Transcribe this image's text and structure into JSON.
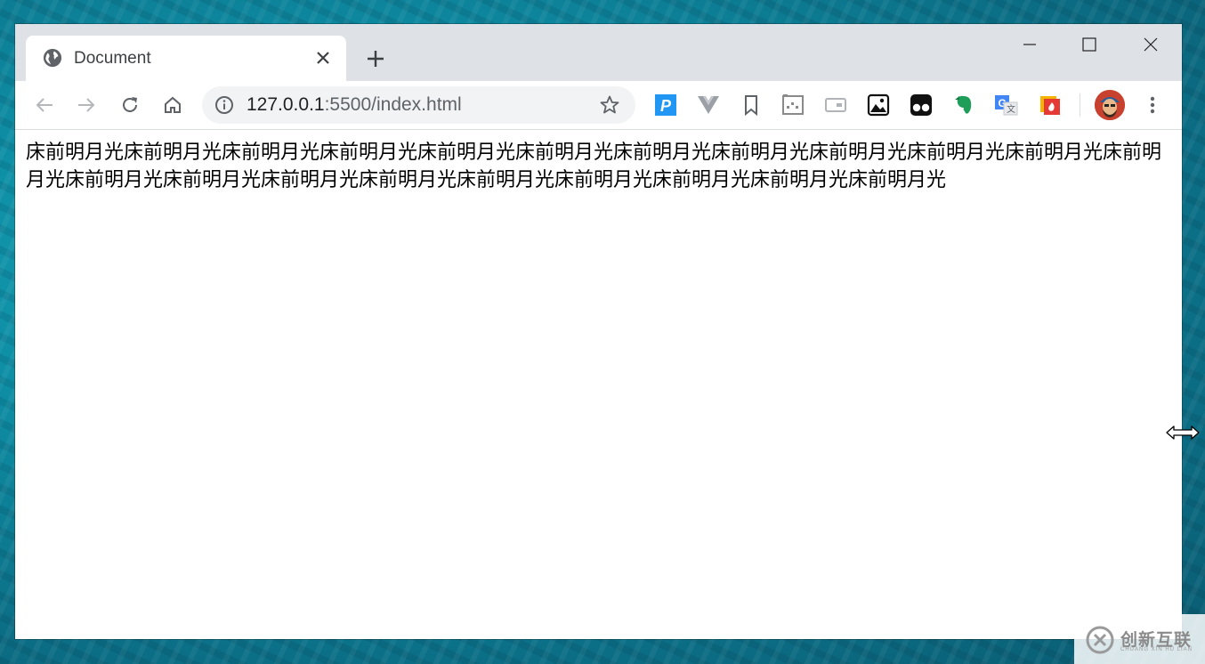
{
  "tab": {
    "title": "Document",
    "favicon": "globe-icon"
  },
  "window_controls": [
    "minimize-icon",
    "maximize-icon",
    "close-icon"
  ],
  "omnibox": {
    "host": "127.0.0.1",
    "rest": ":5500/index.html"
  },
  "extensions": [
    "p-extension-icon",
    "vue-devtools-icon",
    "bookmark-ext-icon",
    "pixel-ext-icon",
    "card-ext-icon",
    "image-ext-icon",
    "tampermonkey-icon",
    "evernote-icon",
    "translate-icon",
    "fire-ext-icon"
  ],
  "page": {
    "text": "床前明月光床前明月光床前明月光床前明月光床前明月光床前明月光床前明月光床前明月光床前明月光床前明月光床前明月光床前明月光床前明月光床前明月光床前明月光床前明月光床前明月光床前明月光床前明月光床前明月光床前明月光"
  },
  "watermark": {
    "main": "创新互联",
    "sub": "CHUANG XIN HU LIAN"
  }
}
